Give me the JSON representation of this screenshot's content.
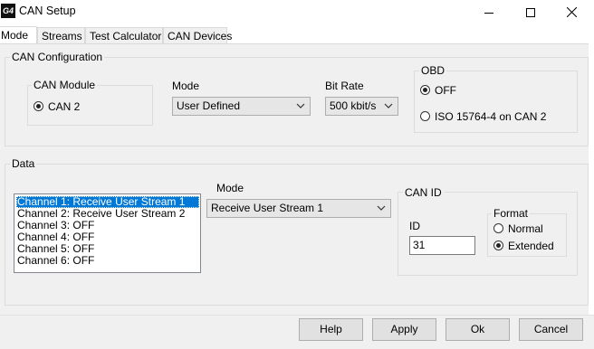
{
  "window": {
    "title": "CAN Setup",
    "app_icon_text": "G4"
  },
  "tabs": [
    {
      "label": "Mode",
      "active": true
    },
    {
      "label": "Streams",
      "active": false
    },
    {
      "label": "Test Calculator",
      "active": false
    },
    {
      "label": "CAN Devices",
      "active": false
    }
  ],
  "can_config": {
    "group_label": "CAN Configuration",
    "module": {
      "label": "CAN Module",
      "option": "CAN 2",
      "selected": true
    },
    "mode": {
      "label": "Mode",
      "value": "User Defined"
    },
    "bit_rate": {
      "label": "Bit Rate",
      "value": "500 kbit/s"
    },
    "obd": {
      "label": "OBD",
      "options": [
        {
          "label": "OFF",
          "selected": true
        },
        {
          "label": "ISO 15764-4 on CAN 2",
          "selected": false
        }
      ]
    }
  },
  "data": {
    "group_label": "Data",
    "channels": [
      {
        "label": "Channel 1: Receive User Stream 1",
        "selected": true
      },
      {
        "label": "Channel 2: Receive User Stream 2",
        "selected": false
      },
      {
        "label": "Channel 3: OFF",
        "selected": false
      },
      {
        "label": "Channel 4: OFF",
        "selected": false
      },
      {
        "label": "Channel 5: OFF",
        "selected": false
      },
      {
        "label": "Channel 6: OFF",
        "selected": false
      }
    ],
    "mode": {
      "label": "Mode",
      "value": "Receive User Stream 1"
    },
    "can_id": {
      "label": "CAN ID",
      "id_label": "ID",
      "id_value": "31",
      "format": {
        "label": "Format",
        "options": [
          {
            "label": "Normal",
            "selected": false
          },
          {
            "label": "Extended",
            "selected": true
          }
        ]
      }
    }
  },
  "buttons": {
    "help": "Help",
    "apply": "Apply",
    "ok": "Ok",
    "cancel": "Cancel"
  },
  "icons": [
    "app-icon",
    "minimize-icon",
    "maximize-icon",
    "close-icon",
    "chevron-down-icon"
  ]
}
